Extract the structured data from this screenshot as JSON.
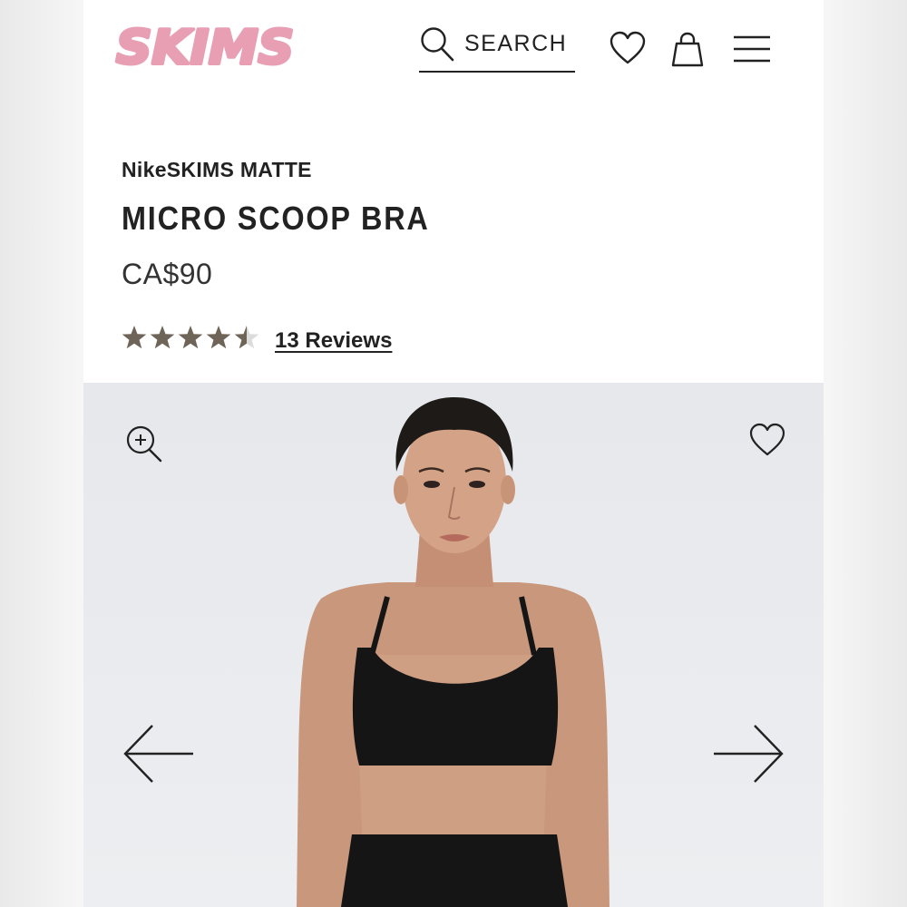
{
  "header": {
    "logo_text": "SKIMS",
    "logo_color": "#e89fb4",
    "search_label": "SEARCH",
    "icons": [
      "search-icon",
      "heart-icon",
      "shopping-bag-icon",
      "hamburger-menu-icon"
    ]
  },
  "product": {
    "brand": "NikeSKIMS MATTE",
    "name": "MICRO SCOOP BRA",
    "price": "CA$90",
    "rating": 4.5,
    "rating_max": 5,
    "reviews_label": "13 Reviews",
    "star_color": "#6e6457"
  },
  "gallery": {
    "icons": [
      "zoom-in-icon",
      "heart-icon",
      "arrow-left-icon",
      "arrow-right-icon"
    ]
  }
}
